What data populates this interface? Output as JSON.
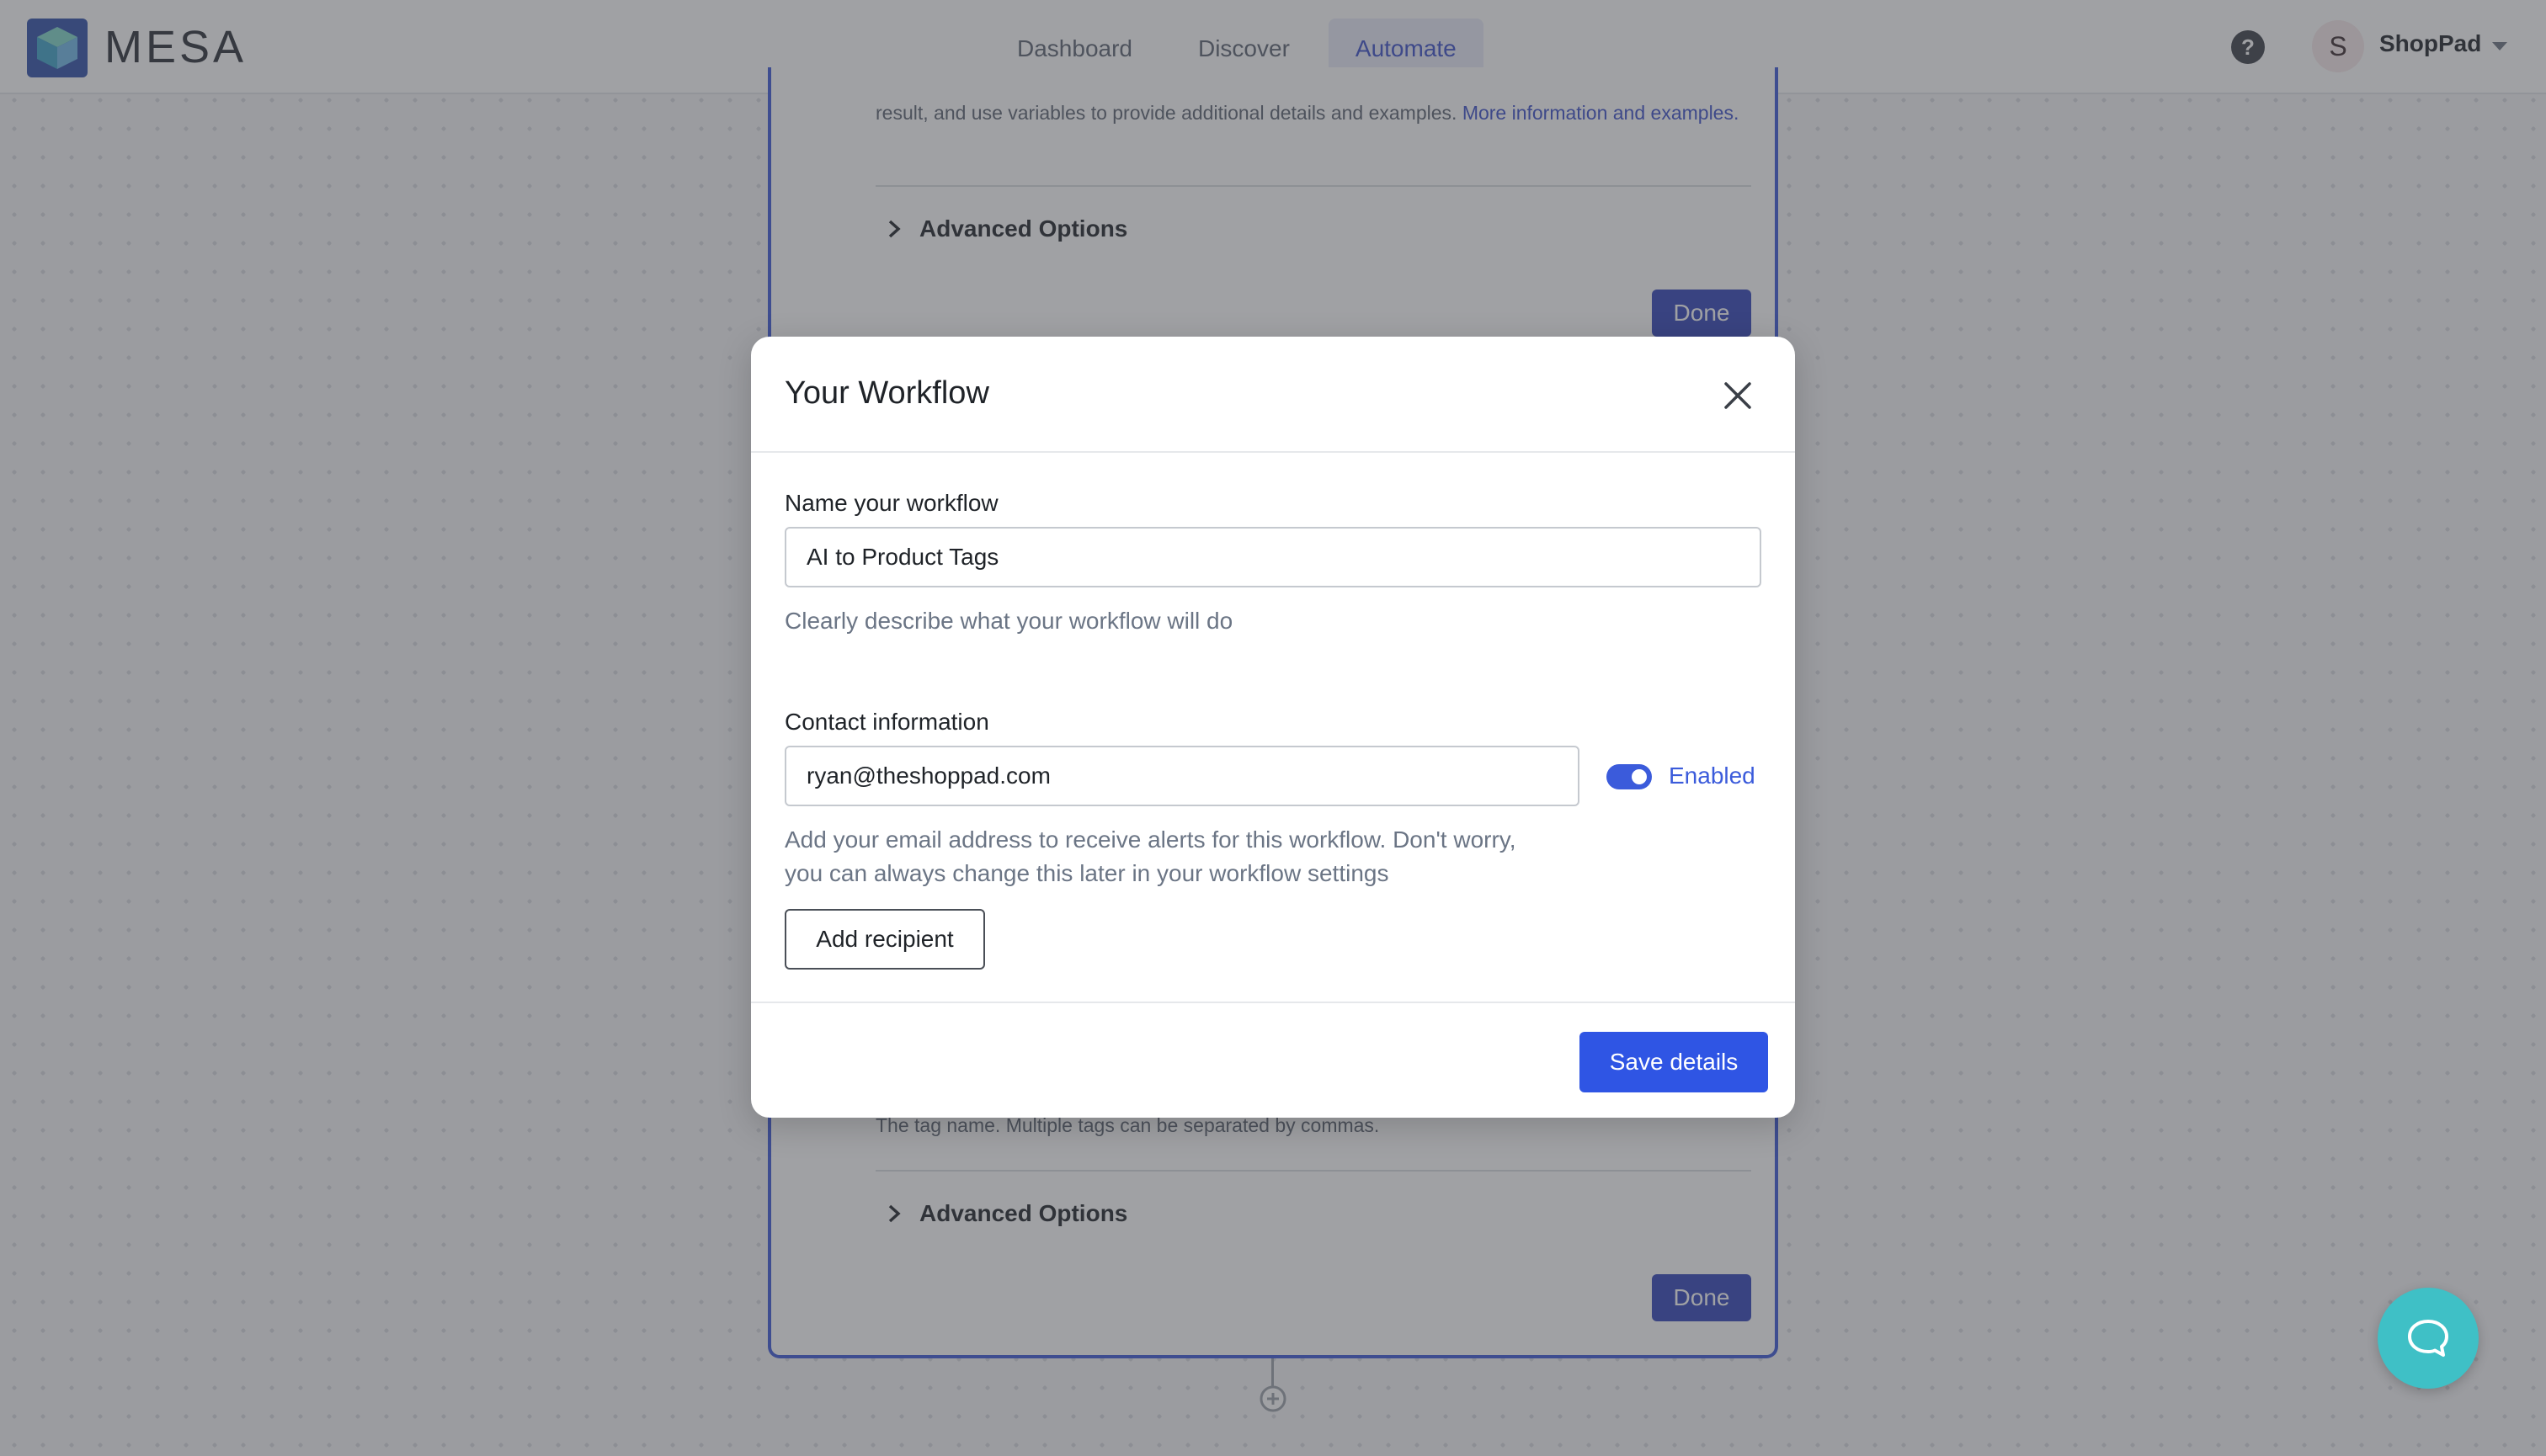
{
  "app": {
    "brand": "MESA",
    "nav": [
      {
        "label": "Dashboard",
        "active": false
      },
      {
        "label": "Discover",
        "active": false
      },
      {
        "label": "Automate",
        "active": true
      }
    ],
    "account": {
      "initial": "S",
      "store_name": "ShopPad"
    },
    "icons": {
      "help": "help-circle-icon",
      "logo": "cube-logo-icon",
      "caret": "caret-down-icon"
    }
  },
  "background": {
    "top_description": "result, and use variables to provide additional details and examples.",
    "top_link": "More information and examples.",
    "advanced_options_label": "Advanced Options",
    "done_label": "Done",
    "tag_hint": "The tag name. Multiple tags can be separated by commas."
  },
  "modal": {
    "title": "Your Workflow",
    "name_label": "Name your workflow",
    "name_value": "AI to Product Tags",
    "name_hint": "Clearly describe what your workflow will do",
    "contact_label": "Contact information",
    "contact_value": "ryan@theshoppad.com",
    "toggle_label": "Enabled",
    "toggle_on": true,
    "contact_hint_line1": "Add your email address to receive alerts for this workflow. Don't worry,",
    "contact_hint_line2": "you can always change this later in your workflow settings",
    "add_recipient_label": "Add recipient",
    "save_label": "Save details"
  },
  "colors": {
    "accent": "#2f55e4",
    "workflow_border": "#3a57d6",
    "chat": "#3fc0c6"
  }
}
